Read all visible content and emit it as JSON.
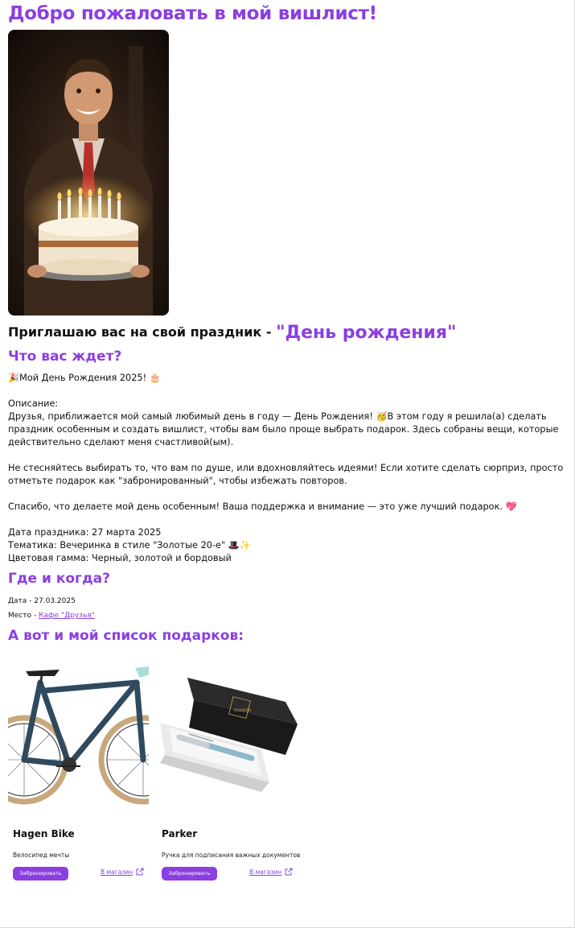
{
  "page": {
    "welcome_title": "Добро пожаловать в мой вишлист!",
    "invite_prefix": "Приглашаю вас на свой праздник - ",
    "event_name": "\"День рождения\""
  },
  "what": {
    "heading": "Что вас ждет?",
    "lines": [
      "🎉Мой День Рождения 2025! 🎂",
      "",
      "Описание:",
      "Друзья, приближается мой самый любимый день в году — День Рождения! 🥳В этом году я решила(а) сделать праздник особенным и создать вишлист, чтобы вам было проще выбрать подарок. Здесь собраны вещи, которые действительно сделают меня счастливой(ым).",
      "",
      "Не стесняйтесь выбирать то, что вам по душе, или вдохновляйтесь идеями! Если хотите сделать сюрприз, просто отметьте подарок как \"забронированный\", чтобы избежать повторов.",
      "",
      "Спасибо, что делаете мой день особенным! Ваша поддержка и внимание — это уже лучший подарок. 💖",
      "",
      "Дата праздника: 27 марта 2025",
      "Тематика: Вечеринка в стиле \"Золотые 20-е\" 🎩✨",
      "Цветовая гамма: Черный, золотой и бордовый"
    ]
  },
  "where": {
    "heading": "Где и когда?",
    "date_label": "Дата - ",
    "date_value": "27.03.2025",
    "place_label": "Место - ",
    "place_value": "Кафе \"Друзья\""
  },
  "gifts": {
    "heading": "А вот и мой список подарков:",
    "items": [
      {
        "name": "Hagen Bike",
        "description": "Велосипед мечты",
        "reserve_label": "Забронировать",
        "shop_label": "В магазин",
        "icon": "external-link-icon"
      },
      {
        "name": "Parker",
        "description": "Ручка для подписания важных документов",
        "reserve_label": "Забронировать",
        "shop_label": "В магазин",
        "icon": "external-link-icon"
      }
    ]
  },
  "colors": {
    "accent": "#8b3fe0",
    "text": "#111111"
  }
}
